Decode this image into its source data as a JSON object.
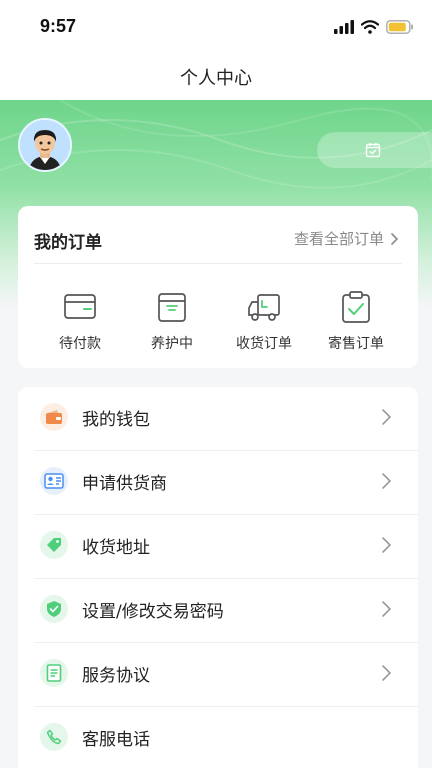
{
  "status_bar": {
    "time": "9:57"
  },
  "nav": {
    "title": "个人中心"
  },
  "profile": {
    "avatar_icon": "user-avatar",
    "checkin_icon": "calendar-check-icon"
  },
  "orders": {
    "title": "我的订单",
    "view_all": "查看全部订单",
    "items": [
      {
        "label": "待付款",
        "icon": "wallet-icon"
      },
      {
        "label": "养护中",
        "icon": "box-icon"
      },
      {
        "label": "收货订单",
        "icon": "truck-icon"
      },
      {
        "label": "寄售订单",
        "icon": "clipboard-check-icon"
      }
    ]
  },
  "menu": {
    "items": [
      {
        "label": "我的钱包",
        "icon": "wallet-icon",
        "color": "#f08a4b"
      },
      {
        "label": "申请供货商",
        "icon": "id-card-icon",
        "color": "#4a8ef0"
      },
      {
        "label": "收货地址",
        "icon": "tag-icon",
        "color": "#4fcf7a"
      },
      {
        "label": "设置/修改交易密码",
        "icon": "shield-check-icon",
        "color": "#4fcf7a"
      },
      {
        "label": "服务协议",
        "icon": "document-icon",
        "color": "#4fcf7a"
      },
      {
        "label": "客服电话",
        "icon": "phone-icon",
        "color": "#4fcf7a"
      }
    ]
  },
  "theme": {
    "accent": "#6fd58b",
    "background": "#f5f6f8"
  }
}
